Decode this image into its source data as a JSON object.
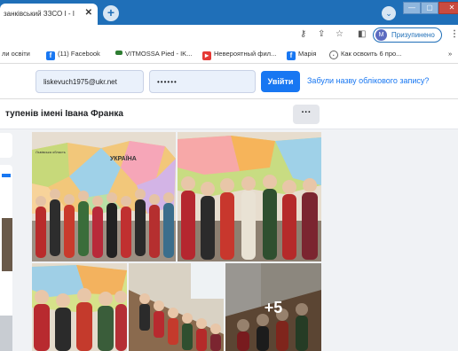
{
  "browser": {
    "tab_title": "занківський ЗЗСО І - І",
    "tab_close": "✕",
    "new_tab": "+",
    "profile_initial": "M",
    "profile_label": "Призупинено",
    "menu_glyph": "⋮",
    "window_dropdown": "⌄",
    "window_min": "—",
    "window_max": "▢",
    "window_close": "✕"
  },
  "bookmarks": [
    {
      "label": "ли освіти",
      "icon": null,
      "color": null
    },
    {
      "label": "(11) Facebook",
      "icon": "facebook-icon",
      "color": "#1877f2"
    },
    {
      "label": "VITMOSSA Pied - IK...",
      "icon": "vitmossa-icon",
      "color": "#2e7d32"
    },
    {
      "label": "Невероятный фил...",
      "icon": "youtube-icon",
      "color": "#e53935"
    },
    {
      "label": "Марія",
      "icon": "facebook-icon",
      "color": "#1877f2"
    },
    {
      "label": "Как освоить 6 про...",
      "icon": "globe-icon",
      "color": "#616161"
    }
  ],
  "bookmarks_overflow": "»",
  "login": {
    "email": "liskevuch1975@ukr.net",
    "password": "••••••",
    "login_button": "Увійти",
    "forgot_link": "Забули назву облікового запису?"
  },
  "page": {
    "title": "тупенів імені Івана Франка",
    "more_button": "···"
  },
  "photos": {
    "map_label_ukraine": "УКРАЇНА",
    "map_label_region": "Львівська область",
    "more_count": "+5"
  },
  "colors": {
    "tabbar": "#1f6fb8",
    "facebook_blue": "#1877f2"
  }
}
